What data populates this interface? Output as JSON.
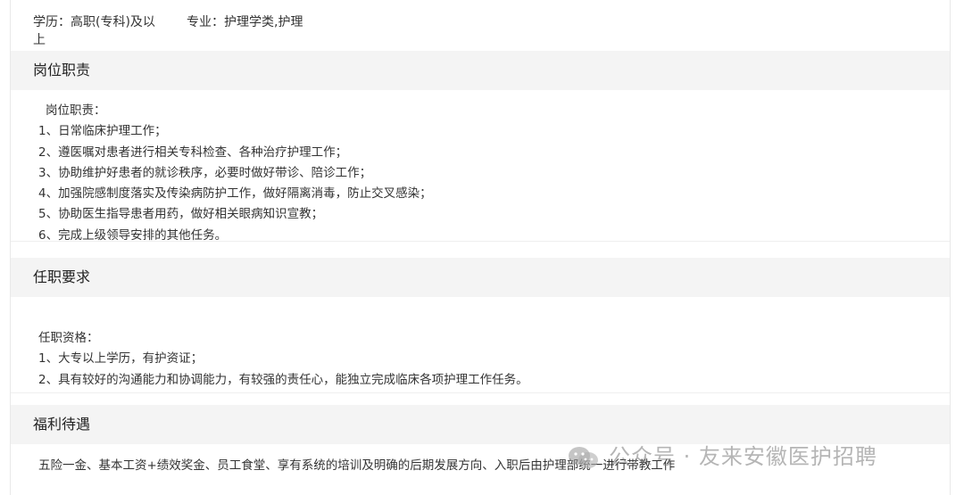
{
  "education": {
    "label": "学历：高职(专科)及以上",
    "major": "专业：护理学类,护理"
  },
  "sections": {
    "duties": {
      "title": "岗位职责",
      "lines": [
        "岗位职责：",
        "1、日常临床护理工作；",
        "2、遵医嘱对患者进行相关专科检查、各种治疗护理工作；",
        "3、协助维护好患者的就诊秩序，必要时做好带诊、陪诊工作；",
        "4、加强院感制度落实及传染病防护工作，做好隔离消毒，防止交叉感染；",
        "5、协助医生指导患者用药，做好相关眼病知识宣教；",
        "6、完成上级领导安排的其他任务。"
      ]
    },
    "requirements": {
      "title": "任职要求",
      "lines": [
        "任职资格：",
        "1、大专以上学历，有护资证；",
        "2、具有较好的沟通能力和协调能力，有较强的责任心，能独立完成临床各项护理工作任务。"
      ]
    },
    "benefits": {
      "title": "福利待遇",
      "text": "五险一金、基本工资+绩效奖金、员工食堂、享有系统的培训及明确的后期发展方向、入职后由护理部统一进行带教工作"
    }
  },
  "watermark": {
    "text": "公众号 · 友来安徽医护招聘",
    "icon": "wechat-icon"
  }
}
